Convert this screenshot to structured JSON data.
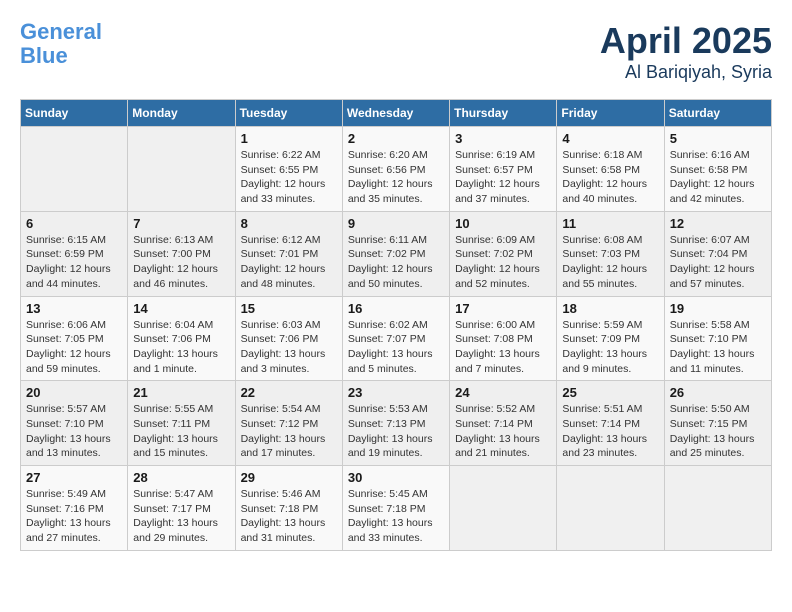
{
  "logo": {
    "line1": "General",
    "line2": "Blue",
    "tagline": ""
  },
  "title": "April 2025",
  "subtitle": "Al Bariqiyah, Syria",
  "weekdays": [
    "Sunday",
    "Monday",
    "Tuesday",
    "Wednesday",
    "Thursday",
    "Friday",
    "Saturday"
  ],
  "weeks": [
    [
      {
        "day": "",
        "info": ""
      },
      {
        "day": "",
        "info": ""
      },
      {
        "day": "1",
        "sunrise": "6:22 AM",
        "sunset": "6:55 PM",
        "daylight": "12 hours and 33 minutes."
      },
      {
        "day": "2",
        "sunrise": "6:20 AM",
        "sunset": "6:56 PM",
        "daylight": "12 hours and 35 minutes."
      },
      {
        "day": "3",
        "sunrise": "6:19 AM",
        "sunset": "6:57 PM",
        "daylight": "12 hours and 37 minutes."
      },
      {
        "day": "4",
        "sunrise": "6:18 AM",
        "sunset": "6:58 PM",
        "daylight": "12 hours and 40 minutes."
      },
      {
        "day": "5",
        "sunrise": "6:16 AM",
        "sunset": "6:58 PM",
        "daylight": "12 hours and 42 minutes."
      }
    ],
    [
      {
        "day": "6",
        "sunrise": "6:15 AM",
        "sunset": "6:59 PM",
        "daylight": "12 hours and 44 minutes."
      },
      {
        "day": "7",
        "sunrise": "6:13 AM",
        "sunset": "7:00 PM",
        "daylight": "12 hours and 46 minutes."
      },
      {
        "day": "8",
        "sunrise": "6:12 AM",
        "sunset": "7:01 PM",
        "daylight": "12 hours and 48 minutes."
      },
      {
        "day": "9",
        "sunrise": "6:11 AM",
        "sunset": "7:02 PM",
        "daylight": "12 hours and 50 minutes."
      },
      {
        "day": "10",
        "sunrise": "6:09 AM",
        "sunset": "7:02 PM",
        "daylight": "12 hours and 52 minutes."
      },
      {
        "day": "11",
        "sunrise": "6:08 AM",
        "sunset": "7:03 PM",
        "daylight": "12 hours and 55 minutes."
      },
      {
        "day": "12",
        "sunrise": "6:07 AM",
        "sunset": "7:04 PM",
        "daylight": "12 hours and 57 minutes."
      }
    ],
    [
      {
        "day": "13",
        "sunrise": "6:06 AM",
        "sunset": "7:05 PM",
        "daylight": "12 hours and 59 minutes."
      },
      {
        "day": "14",
        "sunrise": "6:04 AM",
        "sunset": "7:06 PM",
        "daylight": "13 hours and 1 minute."
      },
      {
        "day": "15",
        "sunrise": "6:03 AM",
        "sunset": "7:06 PM",
        "daylight": "13 hours and 3 minutes."
      },
      {
        "day": "16",
        "sunrise": "6:02 AM",
        "sunset": "7:07 PM",
        "daylight": "13 hours and 5 minutes."
      },
      {
        "day": "17",
        "sunrise": "6:00 AM",
        "sunset": "7:08 PM",
        "daylight": "13 hours and 7 minutes."
      },
      {
        "day": "18",
        "sunrise": "5:59 AM",
        "sunset": "7:09 PM",
        "daylight": "13 hours and 9 minutes."
      },
      {
        "day": "19",
        "sunrise": "5:58 AM",
        "sunset": "7:10 PM",
        "daylight": "13 hours and 11 minutes."
      }
    ],
    [
      {
        "day": "20",
        "sunrise": "5:57 AM",
        "sunset": "7:10 PM",
        "daylight": "13 hours and 13 minutes."
      },
      {
        "day": "21",
        "sunrise": "5:55 AM",
        "sunset": "7:11 PM",
        "daylight": "13 hours and 15 minutes."
      },
      {
        "day": "22",
        "sunrise": "5:54 AM",
        "sunset": "7:12 PM",
        "daylight": "13 hours and 17 minutes."
      },
      {
        "day": "23",
        "sunrise": "5:53 AM",
        "sunset": "7:13 PM",
        "daylight": "13 hours and 19 minutes."
      },
      {
        "day": "24",
        "sunrise": "5:52 AM",
        "sunset": "7:14 PM",
        "daylight": "13 hours and 21 minutes."
      },
      {
        "day": "25",
        "sunrise": "5:51 AM",
        "sunset": "7:14 PM",
        "daylight": "13 hours and 23 minutes."
      },
      {
        "day": "26",
        "sunrise": "5:50 AM",
        "sunset": "7:15 PM",
        "daylight": "13 hours and 25 minutes."
      }
    ],
    [
      {
        "day": "27",
        "sunrise": "5:49 AM",
        "sunset": "7:16 PM",
        "daylight": "13 hours and 27 minutes."
      },
      {
        "day": "28",
        "sunrise": "5:47 AM",
        "sunset": "7:17 PM",
        "daylight": "13 hours and 29 minutes."
      },
      {
        "day": "29",
        "sunrise": "5:46 AM",
        "sunset": "7:18 PM",
        "daylight": "13 hours and 31 minutes."
      },
      {
        "day": "30",
        "sunrise": "5:45 AM",
        "sunset": "7:18 PM",
        "daylight": "13 hours and 33 minutes."
      },
      {
        "day": "",
        "info": ""
      },
      {
        "day": "",
        "info": ""
      },
      {
        "day": "",
        "info": ""
      }
    ]
  ],
  "labels": {
    "sunrise": "Sunrise:",
    "sunset": "Sunset:",
    "daylight": "Daylight:"
  }
}
